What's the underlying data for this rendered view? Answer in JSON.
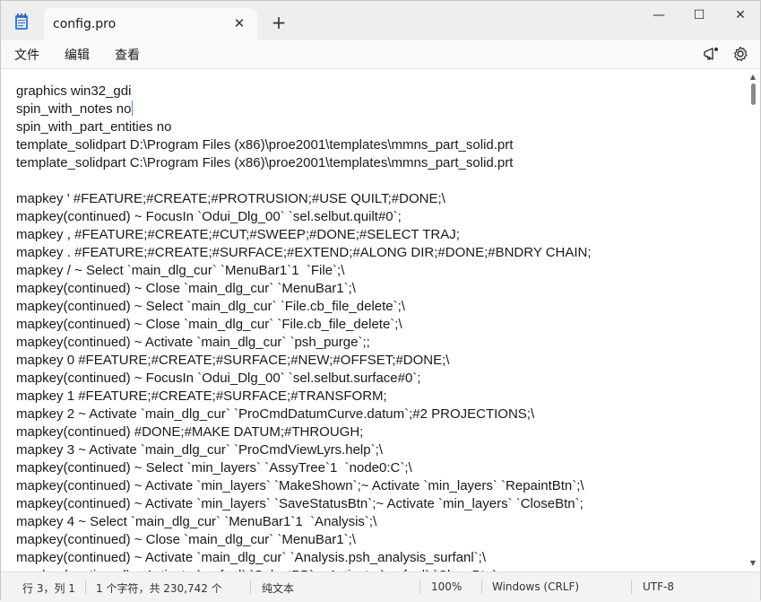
{
  "tab": {
    "title": "config.pro",
    "close": "✕",
    "new": "+"
  },
  "window_controls": {
    "minimize": "—",
    "maximize": "☐",
    "close": "✕"
  },
  "menu": {
    "file": "文件",
    "edit": "编辑",
    "view": "查看"
  },
  "icons": {
    "copilot": "copilot-icon",
    "settings": "gear-icon",
    "app": "notepad-icon"
  },
  "editor": {
    "lines": [
      "graphics win32_gdi",
      "spin_with_notes no",
      "spin_with_part_entities no",
      "template_solidpart D:\\Program Files (x86)\\proe2001\\templates\\mmns_part_solid.prt",
      "template_solidpart C:\\Program Files (x86)\\proe2001\\templates\\mmns_part_solid.prt",
      "",
      "mapkey ' #FEATURE;#CREATE;#PROTRUSION;#USE QUILT;#DONE;\\",
      "mapkey(continued) ~ FocusIn `Odui_Dlg_00` `sel.selbut.quilt#0`;",
      "mapkey , #FEATURE;#CREATE;#CUT;#SWEEP;#DONE;#SELECT TRAJ;",
      "mapkey . #FEATURE;#CREATE;#SURFACE;#EXTEND;#ALONG DIR;#DONE;#BNDRY CHAIN;",
      "mapkey / ~ Select `main_dlg_cur` `MenuBar1`1  `File`;\\",
      "mapkey(continued) ~ Close `main_dlg_cur` `MenuBar1`;\\",
      "mapkey(continued) ~ Select `main_dlg_cur` `File.cb_file_delete`;\\",
      "mapkey(continued) ~ Close `main_dlg_cur` `File.cb_file_delete`;\\",
      "mapkey(continued) ~ Activate `main_dlg_cur` `psh_purge`;;",
      "mapkey 0 #FEATURE;#CREATE;#SURFACE;#NEW;#OFFSET;#DONE;\\",
      "mapkey(continued) ~ FocusIn `Odui_Dlg_00` `sel.selbut.surface#0`;",
      "mapkey 1 #FEATURE;#CREATE;#SURFACE;#TRANSFORM;",
      "mapkey 2 ~ Activate `main_dlg_cur` `ProCmdDatumCurve.datum`;#2 PROJECTIONS;\\",
      "mapkey(continued) #DONE;#MAKE DATUM;#THROUGH;",
      "mapkey 3 ~ Activate `main_dlg_cur` `ProCmdViewLyrs.help`;\\",
      "mapkey(continued) ~ Select `min_layers` `AssyTree`1  `node0:C`;\\",
      "mapkey(continued) ~ Activate `min_layers` `MakeShown`;~ Activate `min_layers` `RepaintBtn`;\\",
      "mapkey(continued) ~ Activate `min_layers` `SaveStatusBtn`;~ Activate `min_layers` `CloseBtn`;",
      "mapkey 4 ~ Select `main_dlg_cur` `MenuBar1`1  `Analysis`;\\",
      "mapkey(continued) ~ Close `main_dlg_cur` `MenuBar1`;\\",
      "mapkey(continued) ~ Activate `main_dlg_cur` `Analysis.psh_analysis_surfanl`;\\",
      "mapkey(continued) ~ Activate `surfanl` `SelectPB`;~ Activate `surfanl` `CloseBtn`;"
    ]
  },
  "status": {
    "position": "行 3，列 1",
    "chars": "1 个字符，共 230,742 个",
    "format": "纯文本",
    "zoom": "100%",
    "line_ending": "Windows (CRLF)",
    "encoding": "UTF-8"
  }
}
